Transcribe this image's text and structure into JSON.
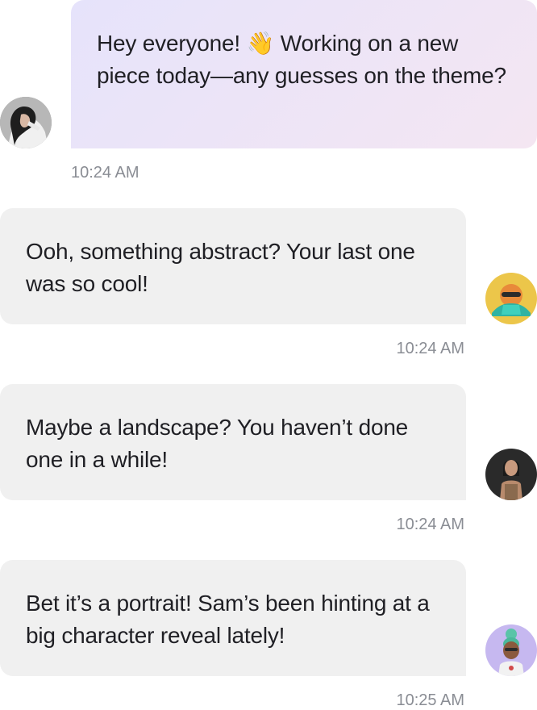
{
  "messages": [
    {
      "direction": "sent",
      "text": "Hey everyone! 👋 Working on a new piece today—any guesses on the theme?",
      "time": "10:24 AM",
      "avatar": "woman-portrait-avatar"
    },
    {
      "direction": "received",
      "text": "Ooh, something abstract? Your last one was so cool!",
      "time": "10:24 AM",
      "avatar": "3d-character-sunglasses-avatar"
    },
    {
      "direction": "received",
      "text": "Maybe a landscape? You haven’t done one in a while!",
      "time": "10:24 AM",
      "avatar": "3d-character-dark-hair-avatar"
    },
    {
      "direction": "received",
      "text": "Bet it’s a portrait! Sam’s been hinting at a big character reveal lately!",
      "time": "10:25 AM",
      "avatar": "3d-character-bun-hair-avatar"
    }
  ],
  "colors": {
    "sent_bubble_start": "#e6e3fb",
    "sent_bubble_end": "#f4e6f2",
    "received_bubble": "#f0f0f0",
    "timestamp": "#8a8d94",
    "text": "#1f1f24"
  }
}
